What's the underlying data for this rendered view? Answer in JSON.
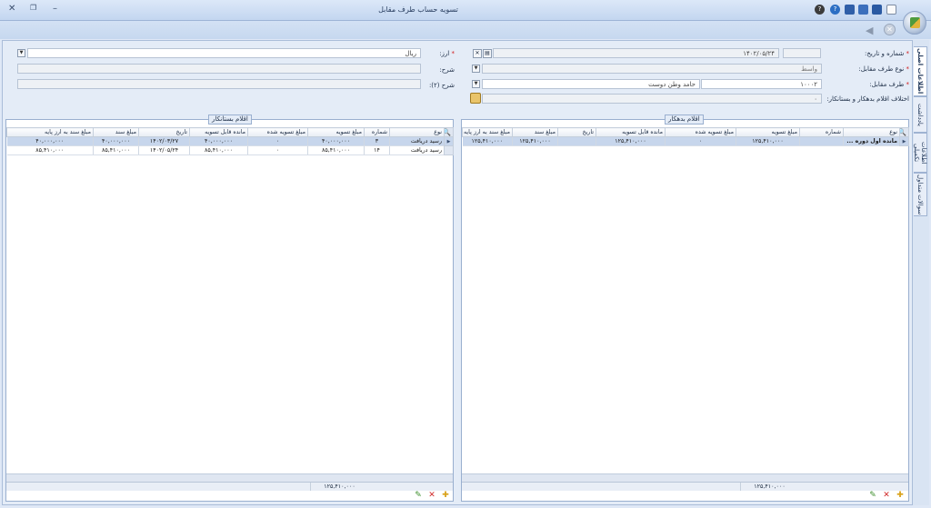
{
  "window": {
    "title": "تسویه حساب طرف مقابل"
  },
  "form": {
    "number_date_label": "شماره و تاریخ:",
    "number_value": "",
    "date_value": "۱۴۰۲/۰۵/۲۴",
    "counterparty_type_label": "نوع طرف مقابل:",
    "counterparty_type_value": "واسط",
    "counterparty_label": "طرف مقابل:",
    "counterparty_code": "۱۰۰۰۲",
    "counterparty_name": "حامد وطن دوست",
    "difference_label": "اختلاف اقلام بدهکار و بستانکار:",
    "difference_value": "۰",
    "currency_label": "ارز:",
    "currency_value": "ریال",
    "description_label": "شرح:",
    "description_value": "",
    "description2_label": "شرح (۲):",
    "description2_value": ""
  },
  "side_tabs": [
    "اطلاعات اصلی",
    "یادداشت",
    "اطلاعات تکمیلی",
    "سوالات متداول"
  ],
  "debit": {
    "title": "اقلام بدهکار",
    "columns": [
      "نوع",
      "شماره",
      "مبلغ تسویه",
      "مبلغ تسویه شده",
      "مانده قابل تسویه",
      "تاریخ",
      "مبلغ سند",
      "مبلغ سند به ارز پایه"
    ],
    "rows": [
      {
        "type": "مانده اول دوره ...",
        "number": "",
        "settle": "۱۲۵,۴۱۰,۰۰۰",
        "settled": "۰",
        "remaining": "۱۲۵,۴۱۰,۰۰۰",
        "date": "",
        "doc_amount": "۱۲۵,۴۱۰,۰۰۰",
        "base_amount": "۱۲۵,۴۱۰,۰۰۰"
      }
    ],
    "footer_total": "۱۲۵,۴۱۰,۰۰۰"
  },
  "credit": {
    "title": "اقلام بستانکار",
    "columns": [
      "نوع",
      "شماره",
      "مبلغ تسویه",
      "مبلغ تسویه شده",
      "مانده قابل تسویه",
      "تاریخ",
      "مبلغ سند",
      "مبلغ سند به ارز پایه"
    ],
    "rows": [
      {
        "type": "رسید دریافت",
        "number": "۳",
        "settle": "۴۰,۰۰۰,۰۰۰",
        "settled": "۰",
        "remaining": "۴۰,۰۰۰,۰۰۰",
        "date": "۱۴۰۲/۰۳/۲۷",
        "doc_amount": "۴۰,۰۰۰,۰۰۰",
        "base_amount": "۴۰,۰۰۰,۰۰۰"
      },
      {
        "type": "رسید دریافت",
        "number": "۱۴",
        "settle": "۸۵,۴۱۰,۰۰۰",
        "settled": "۰",
        "remaining": "۸۵,۴۱۰,۰۰۰",
        "date": "۱۴۰۲/۰۵/۲۴",
        "doc_amount": "۸۵,۴۱۰,۰۰۰",
        "base_amount": "۸۵,۴۱۰,۰۰۰"
      }
    ],
    "footer_total": "۱۲۵,۴۱۰,۰۰۰"
  },
  "colors": {
    "accent": "#c7d6ec",
    "required": "#d21c1c"
  }
}
